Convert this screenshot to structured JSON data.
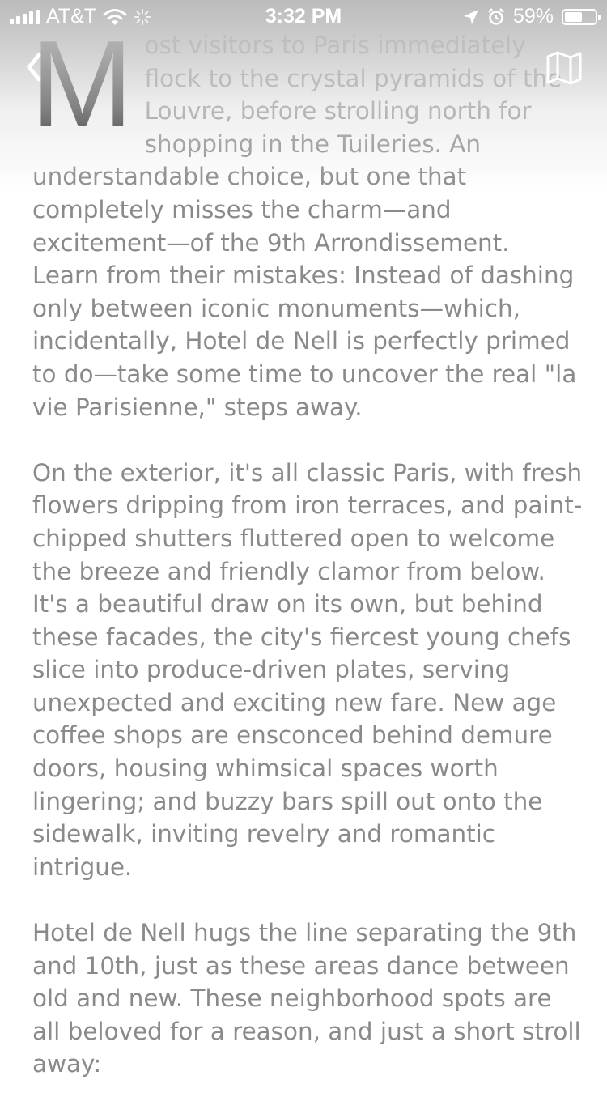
{
  "status_bar": {
    "carrier": "AT&T",
    "time": "3:32 PM",
    "battery_percent": "59%",
    "battery_level": 0.59,
    "icons": [
      "signal-icon",
      "wifi-icon",
      "activity-spinner-icon",
      "location-arrow-icon",
      "alarm-icon",
      "battery-icon"
    ]
  },
  "nav": {
    "back_icon": "chevron-left-icon",
    "map_icon": "map-icon"
  },
  "article": {
    "drop_cap": "M",
    "paragraph_1_rest": "ost visitors to Paris immediately flock to the crystal pyramids of the Louvre, before strolling north for shopping in the Tuileries. An understandable choice, but one that completely misses the charm—and excitement—of the 9th Arrondissement. Learn from their mistakes: Instead of dashing only between iconic monuments—which, incidentally, Hotel de Nell is perfectly primed to do—take some time to uncover the real \"la vie Parisienne,\" steps away.",
    "paragraph_2": "On the exterior, it's all classic Paris, with fresh flowers dripping from iron terraces, and paint-chipped shutters fluttered open to welcome the breeze and friendly clamor from below. It's a beautiful draw on its own, but behind these facades, the city's fiercest young chefs slice into produce-driven plates, serving unexpected and exciting new fare. New age coffee shops are ensconced behind demure doors, housing whimsical spaces worth lingering; and buzzy bars spill out onto the sidewalk, inviting revelry and romantic intrigue.",
    "paragraph_3": "Hotel de Nell hugs the line separating the 9th and 10th, just as these areas dance between old and new. These neighborhood spots are all beloved for a reason, and just a short stroll away:"
  },
  "colors": {
    "body_text": "#8a8a8a",
    "drop_cap": "#111111",
    "status_text": "#ffffff",
    "top_fade": "#b9b9b9"
  }
}
